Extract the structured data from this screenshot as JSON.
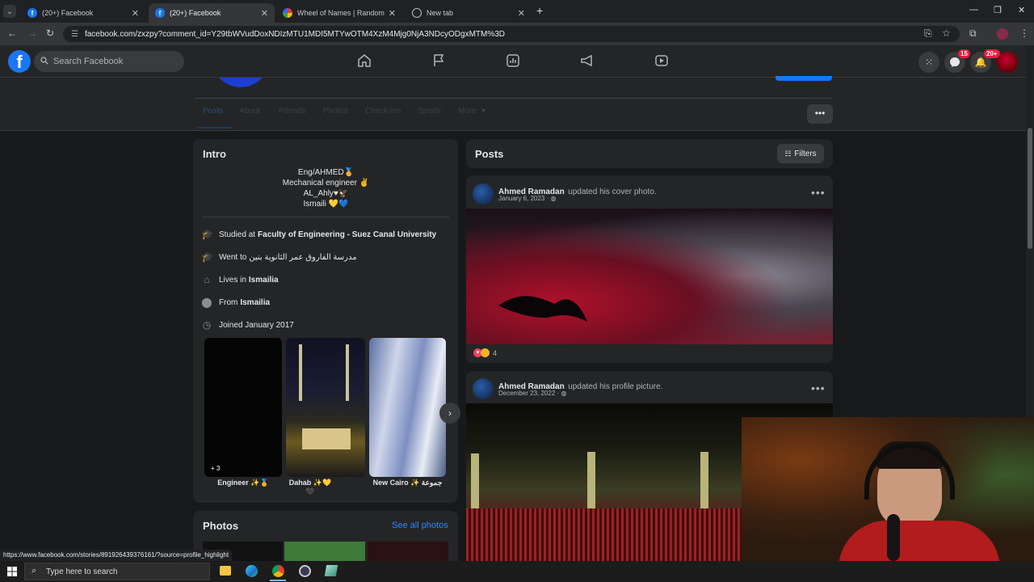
{
  "browser": {
    "tabs": [
      {
        "label": "(20+) Facebook",
        "active": false
      },
      {
        "label": "(20+) Facebook",
        "active": true
      },
      {
        "label": "Wheel of Names | Random nam",
        "active": false
      },
      {
        "label": "New tab",
        "active": false
      }
    ],
    "url": "facebook.com/zxzpy?comment_id=Y29tbWVudDoxNDIzMTU1MDI5MTYwOTM4XzM4Mjg0NjA3NDcyODgxMTM%3D",
    "status_url": "https://www.facebook.com/stories/891926439376161/?source=profile_highlight"
  },
  "fb_header": {
    "search_placeholder": "Search Facebook",
    "messenger_badge": "15",
    "notifications_badge": "20+"
  },
  "profile_tabs": [
    "Posts",
    "About",
    "Friends",
    "Photos",
    "Check-ins",
    "Sports",
    "More"
  ],
  "intro": {
    "title": "Intro",
    "bio_lines": [
      "Eng/AHMED🏅",
      "Mechanical engineer ✌",
      "AL_Ahly♥🦅",
      "Ismaili 💛💙"
    ],
    "details": [
      {
        "icon": "graduation-cap-icon",
        "prefix": "Studied at",
        "value": "Faculty of Engineering - Suez Canal University"
      },
      {
        "icon": "graduation-cap-icon",
        "prefix": "Went to",
        "value": "مدرسة الفاروق عمر الثانوية بنين"
      },
      {
        "icon": "house-icon",
        "prefix": "Lives in",
        "value": "Ismailia"
      },
      {
        "icon": "location-pin-icon",
        "prefix": "From",
        "value": "Ismailia"
      },
      {
        "icon": "clock-icon",
        "prefix": "Joined January 2017",
        "value": ""
      }
    ],
    "highlights": [
      {
        "label": "Engineer ✨🏅",
        "count": "+ 3"
      },
      {
        "label": "Dahab ✨💛🖤",
        "count": ""
      },
      {
        "label": "New Cairo ✨ جموعة",
        "count": ""
      }
    ]
  },
  "photos": {
    "title": "Photos",
    "see_all": "See all photos"
  },
  "posts": {
    "title": "Posts",
    "filters_label": "Filters",
    "items": [
      {
        "author": "Ahmed Ramadan",
        "action": "updated his cover photo.",
        "date": "January 6, 2023 ·",
        "reactions": "4"
      },
      {
        "author": "Ahmed Ramadan",
        "action": "updated his profile picture.",
        "date": "December 23, 2022 ·"
      }
    ]
  },
  "taskbar": {
    "search_placeholder": "Type here to search"
  },
  "colors": {
    "fb_blue": "#1877f2",
    "card_bg": "#242526",
    "page_bg": "#18191a",
    "link": "#2d88ff"
  }
}
